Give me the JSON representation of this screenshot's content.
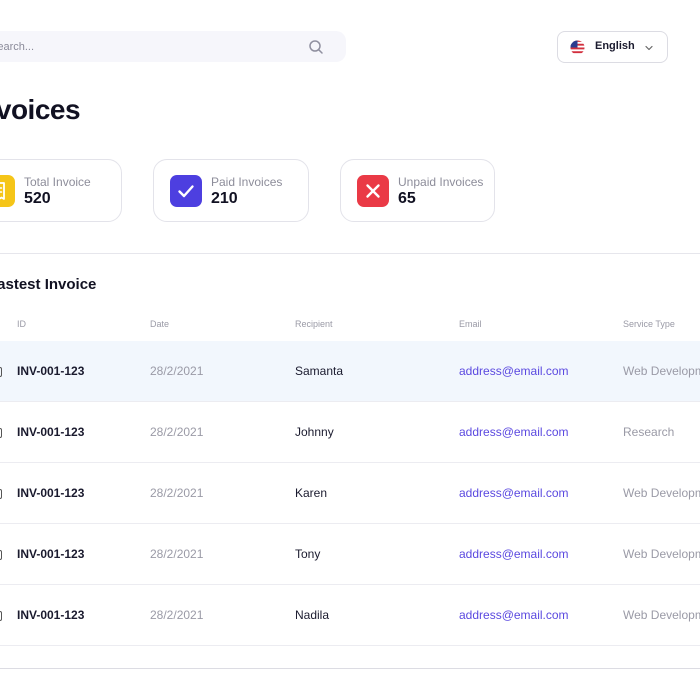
{
  "search": {
    "placeholder": "Search..."
  },
  "language": {
    "label": "English"
  },
  "page_title": "Invoices",
  "stats": [
    {
      "label": "Total Invoice",
      "value": "520",
      "icon": "receipt-icon",
      "color": "#f5c518"
    },
    {
      "label": "Paid Invoices",
      "value": "210",
      "icon": "check-icon",
      "color": "#4d3fe0"
    },
    {
      "label": "Unpaid Invoices",
      "value": "65",
      "icon": "x-icon",
      "color": "#ea3a46"
    }
  ],
  "section_title": "Lastest Invoice",
  "table": {
    "headers": [
      "ID",
      "Date",
      "Recipient",
      "Email",
      "Service Type"
    ],
    "rows": [
      {
        "id": "INV-001-123",
        "date": "28/2/2021",
        "recipient": "Samanta",
        "email": "address@email.com",
        "service": "Web Development"
      },
      {
        "id": "INV-001-123",
        "date": "28/2/2021",
        "recipient": "Johnny",
        "email": "address@email.com",
        "service": "Research"
      },
      {
        "id": "INV-001-123",
        "date": "28/2/2021",
        "recipient": "Karen",
        "email": "address@email.com",
        "service": "Web Development"
      },
      {
        "id": "INV-001-123",
        "date": "28/2/2021",
        "recipient": "Tony",
        "email": "address@email.com",
        "service": "Web Development"
      },
      {
        "id": "INV-001-123",
        "date": "28/2/2021",
        "recipient": "Nadila",
        "email": "address@email.com",
        "service": "Web Development"
      }
    ]
  }
}
